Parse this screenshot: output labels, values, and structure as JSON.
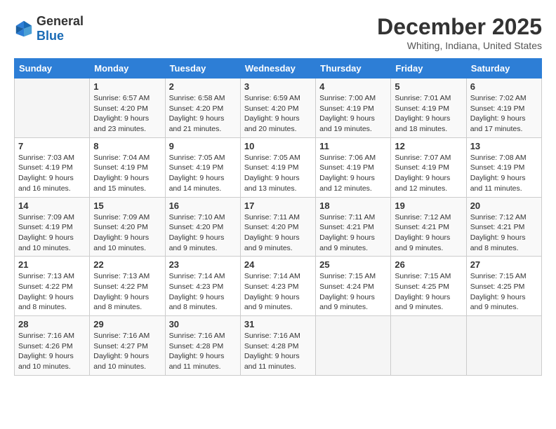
{
  "header": {
    "logo_line1": "General",
    "logo_line2": "Blue",
    "month_title": "December 2025",
    "subtitle": "Whiting, Indiana, United States"
  },
  "weekdays": [
    "Sunday",
    "Monday",
    "Tuesday",
    "Wednesday",
    "Thursday",
    "Friday",
    "Saturday"
  ],
  "weeks": [
    [
      {
        "day": "",
        "sunrise": "",
        "sunset": "",
        "daylight": ""
      },
      {
        "day": "1",
        "sunrise": "Sunrise: 6:57 AM",
        "sunset": "Sunset: 4:20 PM",
        "daylight": "Daylight: 9 hours and 23 minutes."
      },
      {
        "day": "2",
        "sunrise": "Sunrise: 6:58 AM",
        "sunset": "Sunset: 4:20 PM",
        "daylight": "Daylight: 9 hours and 21 minutes."
      },
      {
        "day": "3",
        "sunrise": "Sunrise: 6:59 AM",
        "sunset": "Sunset: 4:20 PM",
        "daylight": "Daylight: 9 hours and 20 minutes."
      },
      {
        "day": "4",
        "sunrise": "Sunrise: 7:00 AM",
        "sunset": "Sunset: 4:19 PM",
        "daylight": "Daylight: 9 hours and 19 minutes."
      },
      {
        "day": "5",
        "sunrise": "Sunrise: 7:01 AM",
        "sunset": "Sunset: 4:19 PM",
        "daylight": "Daylight: 9 hours and 18 minutes."
      },
      {
        "day": "6",
        "sunrise": "Sunrise: 7:02 AM",
        "sunset": "Sunset: 4:19 PM",
        "daylight": "Daylight: 9 hours and 17 minutes."
      }
    ],
    [
      {
        "day": "7",
        "sunrise": "Sunrise: 7:03 AM",
        "sunset": "Sunset: 4:19 PM",
        "daylight": "Daylight: 9 hours and 16 minutes."
      },
      {
        "day": "8",
        "sunrise": "Sunrise: 7:04 AM",
        "sunset": "Sunset: 4:19 PM",
        "daylight": "Daylight: 9 hours and 15 minutes."
      },
      {
        "day": "9",
        "sunrise": "Sunrise: 7:05 AM",
        "sunset": "Sunset: 4:19 PM",
        "daylight": "Daylight: 9 hours and 14 minutes."
      },
      {
        "day": "10",
        "sunrise": "Sunrise: 7:05 AM",
        "sunset": "Sunset: 4:19 PM",
        "daylight": "Daylight: 9 hours and 13 minutes."
      },
      {
        "day": "11",
        "sunrise": "Sunrise: 7:06 AM",
        "sunset": "Sunset: 4:19 PM",
        "daylight": "Daylight: 9 hours and 12 minutes."
      },
      {
        "day": "12",
        "sunrise": "Sunrise: 7:07 AM",
        "sunset": "Sunset: 4:19 PM",
        "daylight": "Daylight: 9 hours and 12 minutes."
      },
      {
        "day": "13",
        "sunrise": "Sunrise: 7:08 AM",
        "sunset": "Sunset: 4:19 PM",
        "daylight": "Daylight: 9 hours and 11 minutes."
      }
    ],
    [
      {
        "day": "14",
        "sunrise": "Sunrise: 7:09 AM",
        "sunset": "Sunset: 4:19 PM",
        "daylight": "Daylight: 9 hours and 10 minutes."
      },
      {
        "day": "15",
        "sunrise": "Sunrise: 7:09 AM",
        "sunset": "Sunset: 4:20 PM",
        "daylight": "Daylight: 9 hours and 10 minutes."
      },
      {
        "day": "16",
        "sunrise": "Sunrise: 7:10 AM",
        "sunset": "Sunset: 4:20 PM",
        "daylight": "Daylight: 9 hours and 9 minutes."
      },
      {
        "day": "17",
        "sunrise": "Sunrise: 7:11 AM",
        "sunset": "Sunset: 4:20 PM",
        "daylight": "Daylight: 9 hours and 9 minutes."
      },
      {
        "day": "18",
        "sunrise": "Sunrise: 7:11 AM",
        "sunset": "Sunset: 4:21 PM",
        "daylight": "Daylight: 9 hours and 9 minutes."
      },
      {
        "day": "19",
        "sunrise": "Sunrise: 7:12 AM",
        "sunset": "Sunset: 4:21 PM",
        "daylight": "Daylight: 9 hours and 9 minutes."
      },
      {
        "day": "20",
        "sunrise": "Sunrise: 7:12 AM",
        "sunset": "Sunset: 4:21 PM",
        "daylight": "Daylight: 9 hours and 8 minutes."
      }
    ],
    [
      {
        "day": "21",
        "sunrise": "Sunrise: 7:13 AM",
        "sunset": "Sunset: 4:22 PM",
        "daylight": "Daylight: 9 hours and 8 minutes."
      },
      {
        "day": "22",
        "sunrise": "Sunrise: 7:13 AM",
        "sunset": "Sunset: 4:22 PM",
        "daylight": "Daylight: 9 hours and 8 minutes."
      },
      {
        "day": "23",
        "sunrise": "Sunrise: 7:14 AM",
        "sunset": "Sunset: 4:23 PM",
        "daylight": "Daylight: 9 hours and 8 minutes."
      },
      {
        "day": "24",
        "sunrise": "Sunrise: 7:14 AM",
        "sunset": "Sunset: 4:23 PM",
        "daylight": "Daylight: 9 hours and 9 minutes."
      },
      {
        "day": "25",
        "sunrise": "Sunrise: 7:15 AM",
        "sunset": "Sunset: 4:24 PM",
        "daylight": "Daylight: 9 hours and 9 minutes."
      },
      {
        "day": "26",
        "sunrise": "Sunrise: 7:15 AM",
        "sunset": "Sunset: 4:25 PM",
        "daylight": "Daylight: 9 hours and 9 minutes."
      },
      {
        "day": "27",
        "sunrise": "Sunrise: 7:15 AM",
        "sunset": "Sunset: 4:25 PM",
        "daylight": "Daylight: 9 hours and 9 minutes."
      }
    ],
    [
      {
        "day": "28",
        "sunrise": "Sunrise: 7:16 AM",
        "sunset": "Sunset: 4:26 PM",
        "daylight": "Daylight: 9 hours and 10 minutes."
      },
      {
        "day": "29",
        "sunrise": "Sunrise: 7:16 AM",
        "sunset": "Sunset: 4:27 PM",
        "daylight": "Daylight: 9 hours and 10 minutes."
      },
      {
        "day": "30",
        "sunrise": "Sunrise: 7:16 AM",
        "sunset": "Sunset: 4:28 PM",
        "daylight": "Daylight: 9 hours and 11 minutes."
      },
      {
        "day": "31",
        "sunrise": "Sunrise: 7:16 AM",
        "sunset": "Sunset: 4:28 PM",
        "daylight": "Daylight: 9 hours and 11 minutes."
      },
      {
        "day": "",
        "sunrise": "",
        "sunset": "",
        "daylight": ""
      },
      {
        "day": "",
        "sunrise": "",
        "sunset": "",
        "daylight": ""
      },
      {
        "day": "",
        "sunrise": "",
        "sunset": "",
        "daylight": ""
      }
    ]
  ]
}
